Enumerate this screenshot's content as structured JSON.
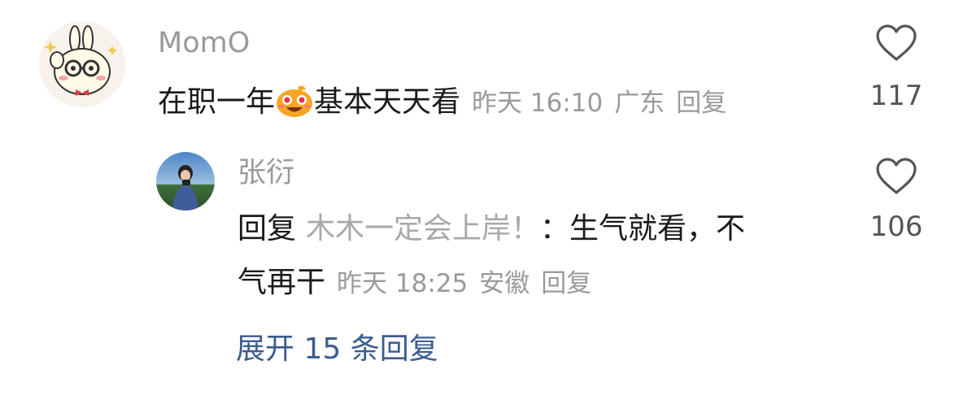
{
  "comment": {
    "username": "MomO",
    "text_before": "在职一年",
    "emoji": "grinning-face-emoji",
    "text_after": "基本天天看",
    "time": "昨天 16:10",
    "location": "广东",
    "reply_label": "回复",
    "like_count": "117"
  },
  "reply": {
    "username": "张衍",
    "reply_prefix": "回复",
    "reply_to": "木木一定会上岸！",
    "text_line1": "：生气就看，不",
    "text_line2": "气再干",
    "time": "昨天 18:25",
    "location": "安徽",
    "reply_label": "回复",
    "like_count": "106"
  },
  "expand_label": "展开 15 条回复",
  "colors": {
    "meta": "#9a9a9a",
    "link": "#3b5c8e",
    "text": "#1a1a1a"
  }
}
